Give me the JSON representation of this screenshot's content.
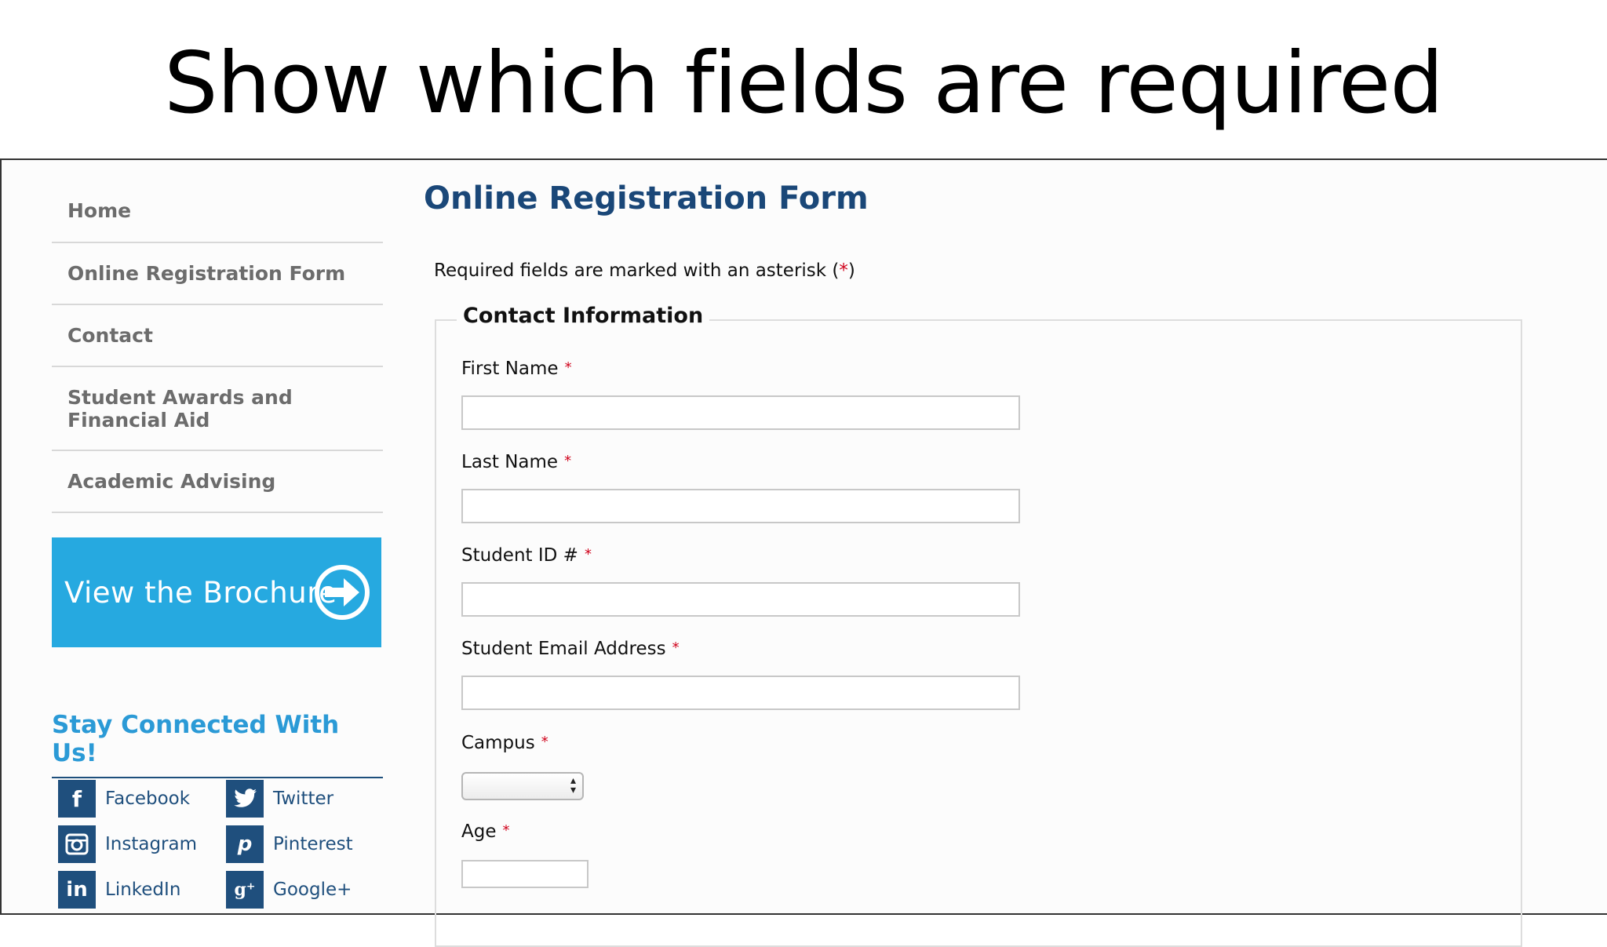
{
  "slide": {
    "title": "Show which fields are required"
  },
  "sidebar": {
    "nav": [
      {
        "label": "Home"
      },
      {
        "label": "Online Registration Form"
      },
      {
        "label": "Contact"
      },
      {
        "label": "Student Awards and Financial Aid"
      },
      {
        "label": "Academic Advising"
      }
    ],
    "brochure_label": "View the Brochure",
    "stay_connected_title": "Stay Connected With Us!",
    "social": [
      {
        "label": "Facebook",
        "icon": "facebook-icon"
      },
      {
        "label": "Twitter",
        "icon": "twitter-icon"
      },
      {
        "label": "Instagram",
        "icon": "instagram-icon"
      },
      {
        "label": "Pinterest",
        "icon": "pinterest-icon"
      },
      {
        "label": "LinkedIn",
        "icon": "linkedin-icon"
      },
      {
        "label": "Google+",
        "icon": "googleplus-icon"
      }
    ]
  },
  "form": {
    "title": "Online Registration Form",
    "required_note_prefix": "Required fields are marked with an asterisk (",
    "required_note_asterisk": "*",
    "required_note_suffix": ")",
    "section_title": "Contact Information",
    "fields": [
      {
        "label": "First Name",
        "required_marker": "*",
        "value": ""
      },
      {
        "label": "Last Name",
        "required_marker": "*",
        "value": ""
      },
      {
        "label": "Student ID #",
        "required_marker": "*",
        "value": ""
      },
      {
        "label": "Student Email Address",
        "required_marker": "*",
        "value": ""
      },
      {
        "label": "Campus",
        "required_marker": "*",
        "value": ""
      },
      {
        "label": "Age",
        "required_marker": "*",
        "value": ""
      }
    ]
  },
  "colors": {
    "brochure_bg": "#26a9e0",
    "title_blue": "#1a4778",
    "required_red": "#d0021b",
    "social_blue": "#1f4f7d"
  }
}
